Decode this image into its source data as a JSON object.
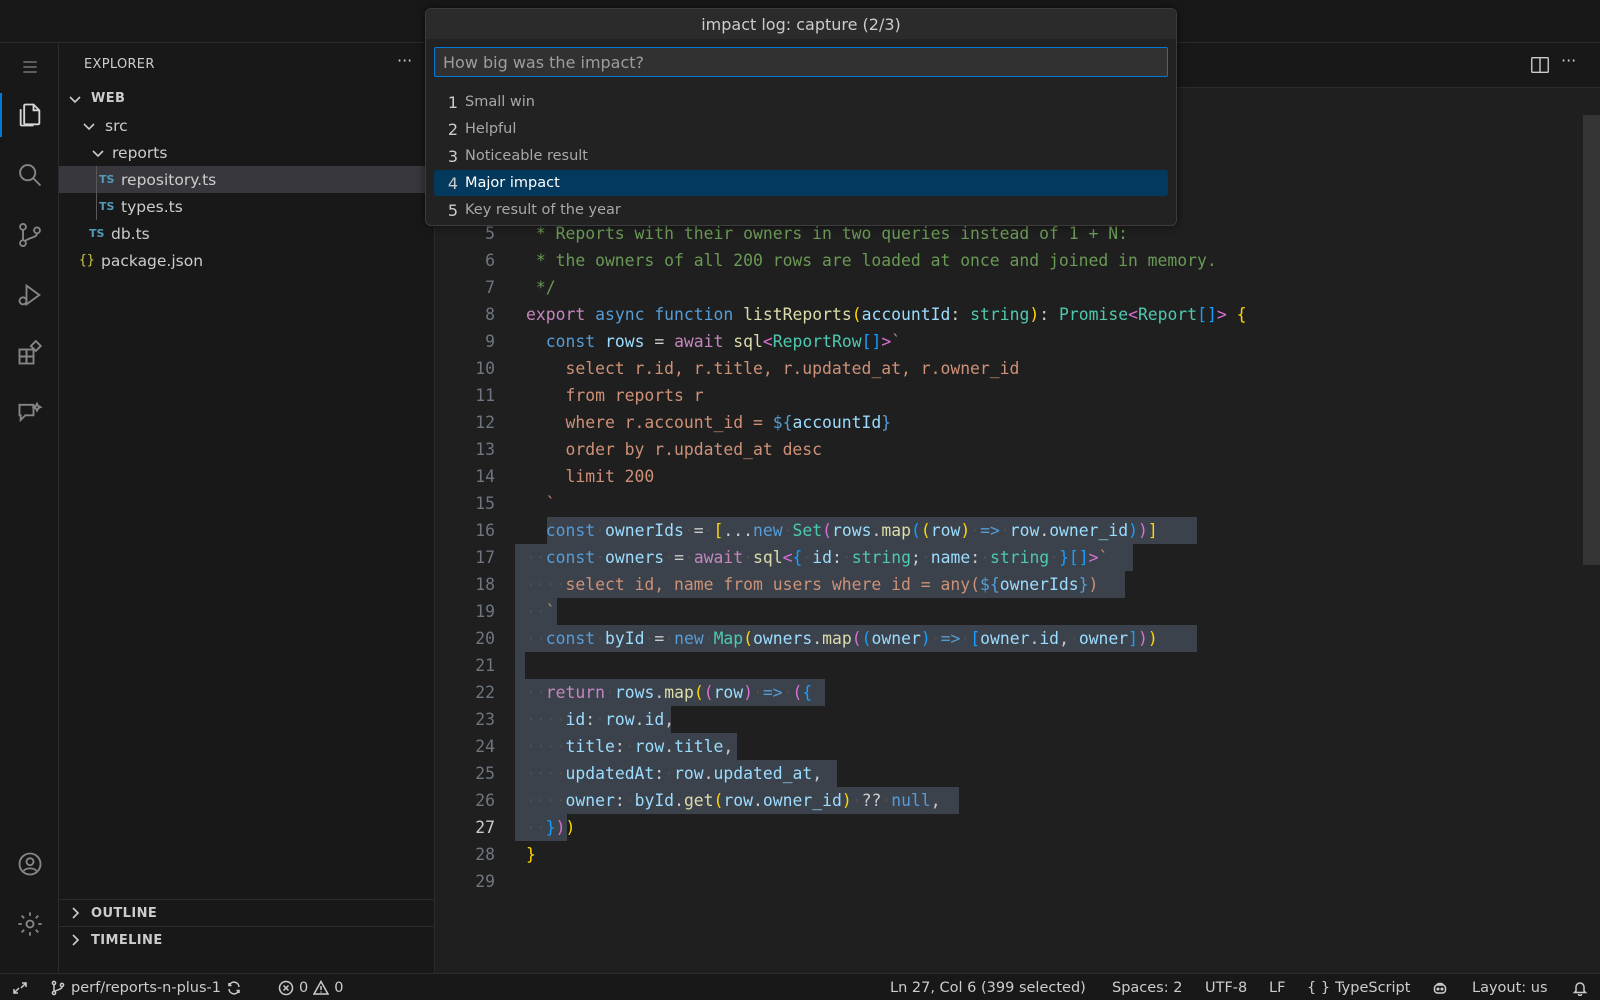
{
  "quick_input": {
    "title": "impact log: capture (2/3)",
    "placeholder": "How big was the impact?",
    "items": [
      {
        "num": "1",
        "label": "Small win"
      },
      {
        "num": "2",
        "label": "Helpful"
      },
      {
        "num": "3",
        "label": "Noticeable result"
      },
      {
        "num": "4",
        "label": "Major impact"
      },
      {
        "num": "5",
        "label": "Key result of the year"
      }
    ]
  },
  "sidebar": {
    "title": "EXPLORER",
    "more": "···",
    "tree": [
      {
        "label": "WEB"
      },
      {
        "label": "src"
      },
      {
        "label": "reports"
      },
      {
        "label": "repository.ts",
        "badge": "TS"
      },
      {
        "label": "types.ts",
        "badge": "TS"
      },
      {
        "label": "db.ts",
        "badge": "TS"
      },
      {
        "label": "package.json",
        "badge": "{}"
      }
    ],
    "sections": {
      "outline": "OUTLINE",
      "timeline": "TIMELINE"
    }
  },
  "editor": {
    "line_numbers": [
      "5",
      "6",
      "7",
      "8",
      "9",
      "10",
      "11",
      "12",
      "13",
      "14",
      "15",
      "16",
      "17",
      "18",
      "19",
      "20",
      "21",
      "22",
      "23",
      "24",
      "25",
      "26",
      "27",
      "28",
      "29"
    ],
    "current_line": "27"
  },
  "statusbar": {
    "branch": "perf/reports-n-plus-1",
    "errors": "0",
    "warnings": "0",
    "position": "Ln 27, Col 6 (399 selected)",
    "spaces": "Spaces: 2",
    "encoding": "UTF-8",
    "eol": "LF",
    "language": "TypeScript",
    "language_glyph": "{ }",
    "layout": "Layout: us"
  },
  "colors": {
    "accent": "#0078d4",
    "selection": "#04395e"
  }
}
